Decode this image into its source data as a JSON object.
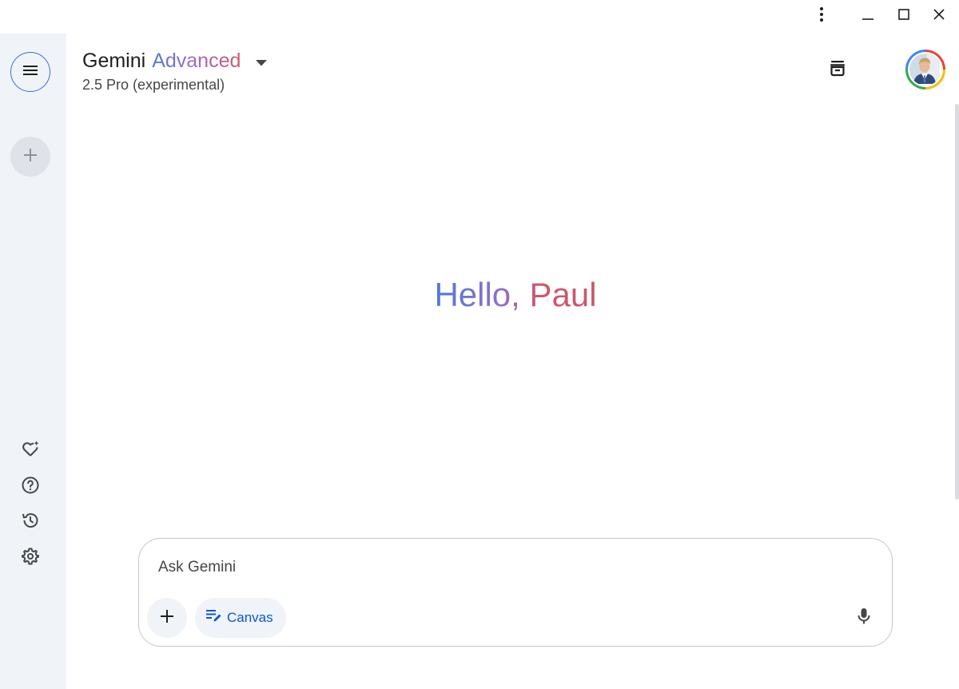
{
  "window": {
    "controls": [
      "more-options",
      "minimize",
      "maximize",
      "close"
    ]
  },
  "sidebar": {
    "top_buttons": [
      {
        "name": "main-menu",
        "icon": "menu-icon"
      },
      {
        "name": "new-chat",
        "icon": "plus-icon"
      }
    ],
    "bottom_items": [
      {
        "name": "gem-manager",
        "icon": "heart-sparkle-icon"
      },
      {
        "name": "help",
        "icon": "help-circle-icon"
      },
      {
        "name": "activity",
        "icon": "history-icon"
      },
      {
        "name": "settings",
        "icon": "gear-icon"
      }
    ]
  },
  "header": {
    "brand": "Gemini",
    "tier": "Advanced",
    "model": "2.5 Pro (experimental)"
  },
  "greeting": {
    "text": "Hello, Paul"
  },
  "prompt": {
    "placeholder": "Ask Gemini",
    "value": "",
    "canvas_label": "Canvas"
  },
  "colors": {
    "accent": "#0b57d0",
    "sidebar_bg": "#f0f4f9",
    "gradient_start": "#4f7bd8",
    "gradient_end": "#d0566b"
  }
}
